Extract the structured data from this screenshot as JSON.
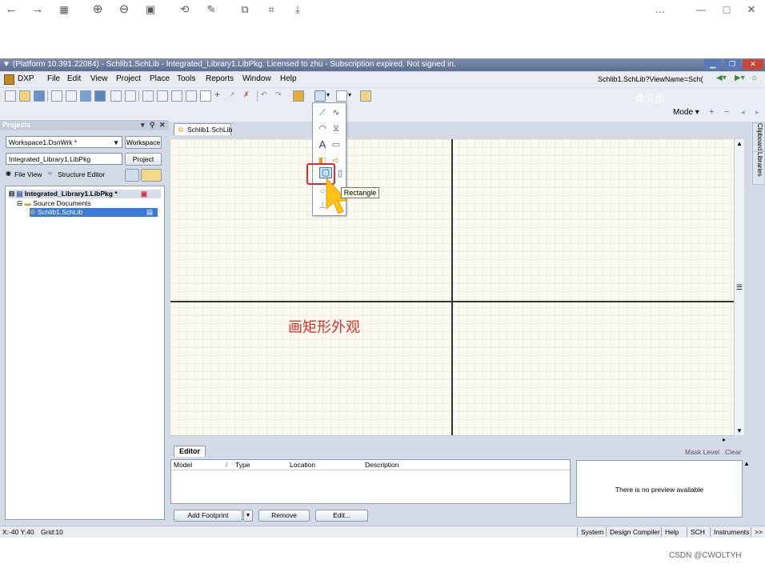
{
  "viewer": {
    "more_label": "…",
    "min_label": "—",
    "max_label": "□",
    "close_label": "✕"
  },
  "app": {
    "title": "(Platform 10.391.22084) - Schlib1.SchLib - Integrated_Library1.LibPkg. Licensed to zhu - Subscription expired. Not signed in.",
    "menu": {
      "dxp": "DXP",
      "items": [
        "File",
        "Edit",
        "View",
        "Project",
        "Place",
        "Tools",
        "Reports",
        "Window",
        "Help"
      ]
    },
    "address": "Schlib1.SchLib?ViewName=Sch(",
    "mode_label": "Mode ▾",
    "overlay_text": "课风那"
  },
  "projects": {
    "header": "Projects",
    "workspace_value": "Workspace1.DsnWrk *",
    "workspace_button": "Workspace",
    "project_value": "Integrated_Library1.LibPkg",
    "project_button": "Project",
    "file_view": "File View",
    "structure_editor": "Structure Editor",
    "tree": {
      "root": "Integrated_Library1.LibPkg *",
      "folder": "Source Documents",
      "doc": "Schlib1.SchLib"
    }
  },
  "document": {
    "tab": "Schlib1.SchLib",
    "caption": "画矩形外观"
  },
  "dropdown": {
    "tooltip": "Rectangle",
    "highlight_color": "#e5262a"
  },
  "side_tabs": [
    "Clipboard",
    "Libraries"
  ],
  "editor": {
    "tab": "Editor",
    "columns": [
      "Model",
      "/",
      "Type",
      "Location",
      "Description"
    ],
    "preview": "There is no preview available",
    "mask_level": "Mask Level",
    "clear": "Clear",
    "add_footprint": "Add Footprint",
    "remove": "Remove",
    "edit": "Edit..."
  },
  "status": {
    "coords": "X:-40 Y:40",
    "grid": "Grid:10",
    "tabs": [
      "System",
      "Design Compiler",
      "Help",
      "SCH",
      "Instruments",
      ">>"
    ]
  },
  "watermark": "CSDN @CWOLTYH"
}
